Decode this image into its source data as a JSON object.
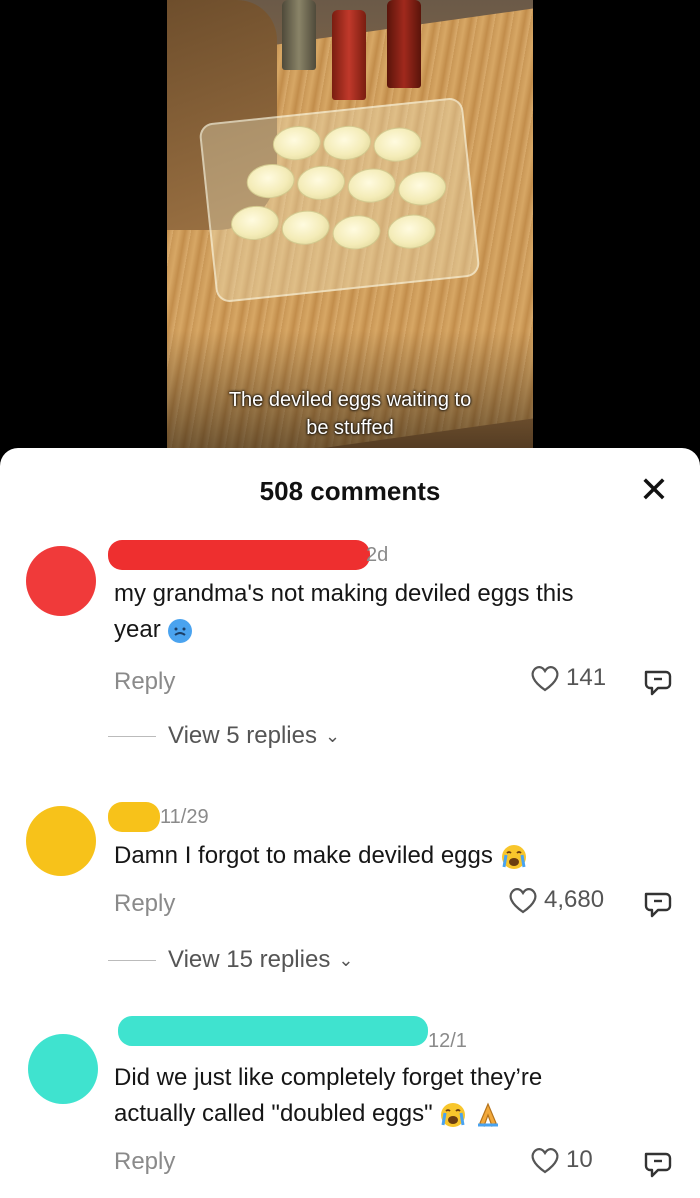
{
  "video": {
    "caption_line1": "The deviled eggs waiting to",
    "caption_line2": "be stuffed"
  },
  "sheet": {
    "title": "508 comments",
    "close_glyph": "✕"
  },
  "comments": [
    {
      "time": "2d",
      "text_line1": "my grandma's not making deviled eggs this",
      "text_line2": "year",
      "reply_label": "Reply",
      "likes": "141",
      "view_replies": "View 5 replies",
      "avatar_color": "#f03a3a",
      "redact_color": "#ee2f2f"
    },
    {
      "time": "11/29",
      "text": "Damn I forgot to make deviled eggs",
      "reply_label": "Reply",
      "likes": "4,680",
      "view_replies": "View 15 replies",
      "avatar_color": "#f7c21a",
      "redact_color": "#f7c21a"
    },
    {
      "time": "12/1",
      "text_line1": "Did we just like completely forget they’re",
      "text_line2": "actually called \"doubled eggs\"",
      "reply_label": "Reply",
      "likes": "10",
      "avatar_color": "#3fe3cf",
      "redact_color": "#3fe3cf"
    }
  ]
}
